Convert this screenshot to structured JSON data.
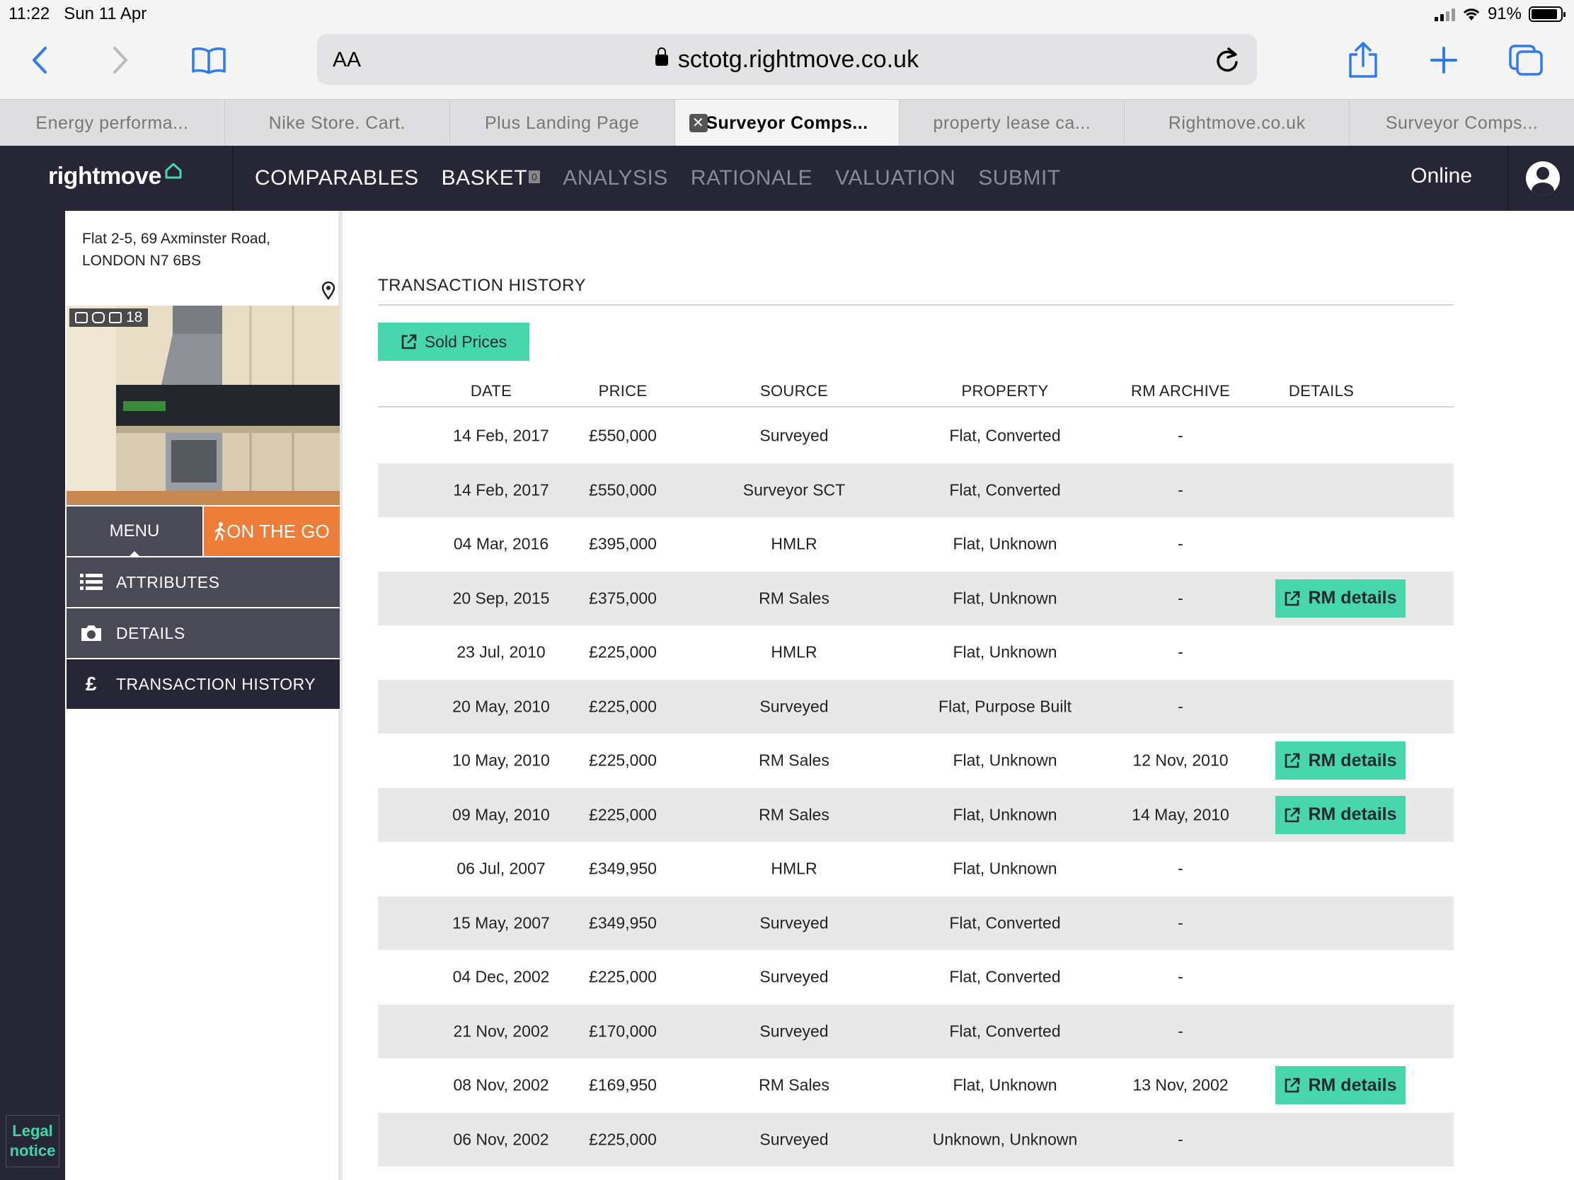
{
  "status_bar": {
    "time": "11:22",
    "date": "Sun 11 Apr",
    "battery": "91%"
  },
  "browser": {
    "text_size_label": "AA",
    "url": "sctotg.rightmove.co.uk",
    "tabs": [
      {
        "label": "Energy performa...",
        "active": false
      },
      {
        "label": "Nike Store. Cart.",
        "active": false
      },
      {
        "label": "Plus Landing Page",
        "active": false
      },
      {
        "label": "Surveyor Comps...",
        "active": true
      },
      {
        "label": "property lease ca...",
        "active": false
      },
      {
        "label": "Rightmove.co.uk",
        "active": false
      },
      {
        "label": "Surveyor Comps...",
        "active": false
      }
    ],
    "tab_close_glyph": "✕"
  },
  "app": {
    "logo": "rightmove",
    "nav": [
      {
        "label": "COMPARABLES",
        "enabled": true
      },
      {
        "label": "BASKET",
        "enabled": true,
        "count": "0"
      },
      {
        "label": "ANALYSIS",
        "enabled": false
      },
      {
        "label": "RATIONALE",
        "enabled": false
      },
      {
        "label": "VALUATION",
        "enabled": false
      },
      {
        "label": "SUBMIT",
        "enabled": false
      }
    ],
    "status": "Online",
    "accent_color": "#48d7ad",
    "nav_bg": "#262637",
    "otg_color": "#ec7e3a"
  },
  "sidebar": {
    "address_line1": "Flat 2-5, 69 Axminster Road,",
    "address_line2": "LONDON N7 6BS",
    "photo_count": "18",
    "menu_label": "MENU",
    "otg_label": "ON THE GO",
    "items": [
      {
        "label": "ATTRIBUTES",
        "icon": "list-icon"
      },
      {
        "label": "DETAILS",
        "icon": "camera-icon"
      },
      {
        "label": "TRANSACTION HISTORY",
        "icon": "pound-icon",
        "glyph": "£",
        "active": true
      }
    ],
    "legal_line1": "Legal",
    "legal_line2": "notice"
  },
  "main": {
    "title": "TRANSACTION HISTORY",
    "sold_prices_label": "Sold Prices",
    "columns": [
      "DATE",
      "PRICE",
      "SOURCE",
      "PROPERTY",
      "RM ARCHIVE",
      "DETAILS"
    ],
    "rm_details_label": "RM details",
    "rows": [
      {
        "date": "14 Feb, 2017",
        "price": "£550,000",
        "source": "Surveyed",
        "property": "Flat, Converted",
        "archive": "-",
        "details": false
      },
      {
        "date": "14 Feb, 2017",
        "price": "£550,000",
        "source": "Surveyor SCT",
        "property": "Flat, Converted",
        "archive": "-",
        "details": false
      },
      {
        "date": "04 Mar, 2016",
        "price": "£395,000",
        "source": "HMLR",
        "property": "Flat, Unknown",
        "archive": "-",
        "details": false
      },
      {
        "date": "20 Sep, 2015",
        "price": "£375,000",
        "source": "RM Sales",
        "property": "Flat, Unknown",
        "archive": "-",
        "details": true
      },
      {
        "date": "23 Jul, 2010",
        "price": "£225,000",
        "source": "HMLR",
        "property": "Flat, Unknown",
        "archive": "-",
        "details": false
      },
      {
        "date": "20 May, 2010",
        "price": "£225,000",
        "source": "Surveyed",
        "property": "Flat, Purpose Built",
        "archive": "-",
        "details": false
      },
      {
        "date": "10 May, 2010",
        "price": "£225,000",
        "source": "RM Sales",
        "property": "Flat, Unknown",
        "archive": "12 Nov, 2010",
        "details": true
      },
      {
        "date": "09 May, 2010",
        "price": "£225,000",
        "source": "RM Sales",
        "property": "Flat, Unknown",
        "archive": "14 May, 2010",
        "details": true
      },
      {
        "date": "06 Jul, 2007",
        "price": "£349,950",
        "source": "HMLR",
        "property": "Flat, Unknown",
        "archive": "-",
        "details": false
      },
      {
        "date": "15 May, 2007",
        "price": "£349,950",
        "source": "Surveyed",
        "property": "Flat, Converted",
        "archive": "-",
        "details": false
      },
      {
        "date": "04 Dec, 2002",
        "price": "£225,000",
        "source": "Surveyed",
        "property": "Flat, Converted",
        "archive": "-",
        "details": false
      },
      {
        "date": "21 Nov, 2002",
        "price": "£170,000",
        "source": "Surveyed",
        "property": "Flat, Converted",
        "archive": "-",
        "details": false
      },
      {
        "date": "08 Nov, 2002",
        "price": "£169,950",
        "source": "RM Sales",
        "property": "Flat, Unknown",
        "archive": "13 Nov, 2002",
        "details": true
      },
      {
        "date": "06 Nov, 2002",
        "price": "£225,000",
        "source": "Surveyed",
        "property": "Unknown, Unknown",
        "archive": "-",
        "details": false
      }
    ]
  }
}
